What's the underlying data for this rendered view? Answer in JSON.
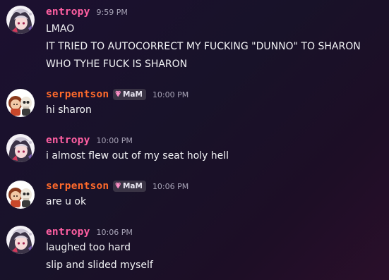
{
  "users": {
    "entropy": {
      "name": "entropy",
      "color": "#ff5fa2"
    },
    "serpentson": {
      "name": "serpentson",
      "color": "#ff6a2b",
      "role_tag": "MaM"
    }
  },
  "messages": [
    {
      "author": "entropy",
      "time": "9:59 PM",
      "lines": [
        "LMAO",
        "IT TRIED TO AUTOCORRECT MY FUCKING \"DUNNO\" TO SHARON",
        "WHO TYHE FUCK IS SHARON"
      ]
    },
    {
      "author": "serpentson",
      "role_tag": "MaM",
      "time": "10:00 PM",
      "lines": [
        "hi sharon"
      ]
    },
    {
      "author": "entropy",
      "time": "10:00 PM",
      "lines": [
        "i almost flew out of my seat holy hell"
      ]
    },
    {
      "author": "serpentson",
      "role_tag": "MaM",
      "time": "10:06 PM",
      "lines": [
        "are u ok"
      ]
    },
    {
      "author": "entropy",
      "time": "10:06 PM",
      "lines": [
        "laughed too hard",
        "slip and slided myself"
      ]
    }
  ],
  "icons": {
    "role_tag_icon": "heart-icon",
    "entropy_avatar": "avatar-entropy",
    "serpentson_avatar": "avatar-serpentson"
  }
}
